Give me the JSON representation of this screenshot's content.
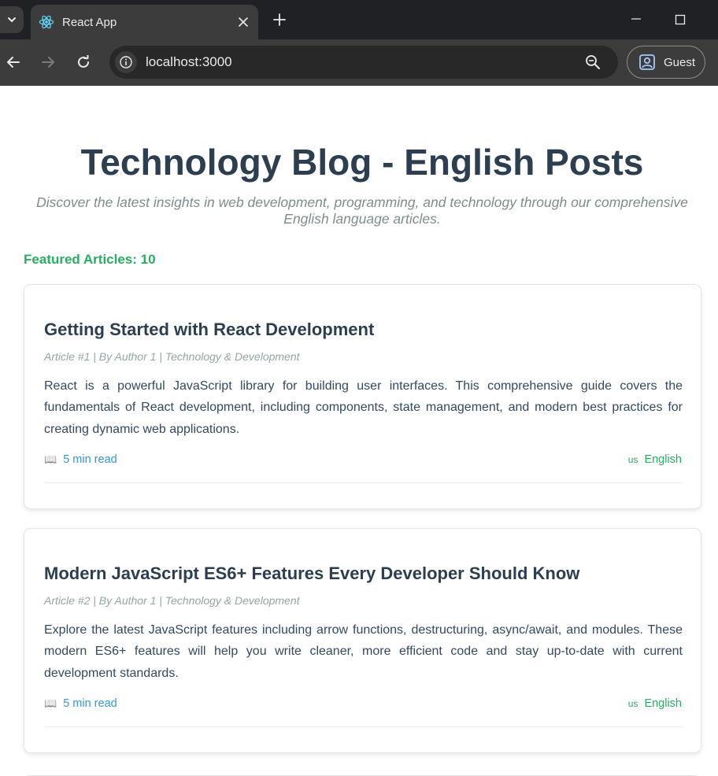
{
  "browser": {
    "tab": {
      "title": "React App",
      "favicon": "react-logo-icon"
    },
    "address_bar": {
      "url": "localhost:3000"
    },
    "profile": {
      "label": "Guest"
    }
  },
  "page": {
    "title": "Technology Blog - English Posts",
    "subtitle": "Discover the latest insights in web development, programming, and technology through our comprehensive English language articles.",
    "featured_label": "Featured Articles: 10"
  },
  "articles": [
    {
      "title": "Getting Started with React Development",
      "meta": "Article #1 | By Author 1 | Technology & Development",
      "body": "React is a powerful JavaScript library for building user interfaces. This comprehensive guide covers the fundamentals of React development, including components, state management, and modern best practices for creating dynamic web applications.",
      "read_icon": "📖",
      "read_time": "5 min read",
      "lang_flag": "us",
      "language": "English"
    },
    {
      "title": "Modern JavaScript ES6+ Features Every Developer Should Know",
      "meta": "Article #2 | By Author 1 | Technology & Development",
      "body": "Explore the latest JavaScript features including arrow functions, destructuring, async/await, and modules. These modern ES6+ features will help you write cleaner, more efficient code and stay up-to-date with current development standards.",
      "read_icon": "📖",
      "read_time": "5 min read",
      "lang_flag": "us",
      "language": "English"
    }
  ],
  "colors": {
    "title": "#2c3e50",
    "featured": "#27ae60",
    "read_time": "#3498db",
    "language": "#27ae60",
    "meta": "#95a5a6"
  }
}
